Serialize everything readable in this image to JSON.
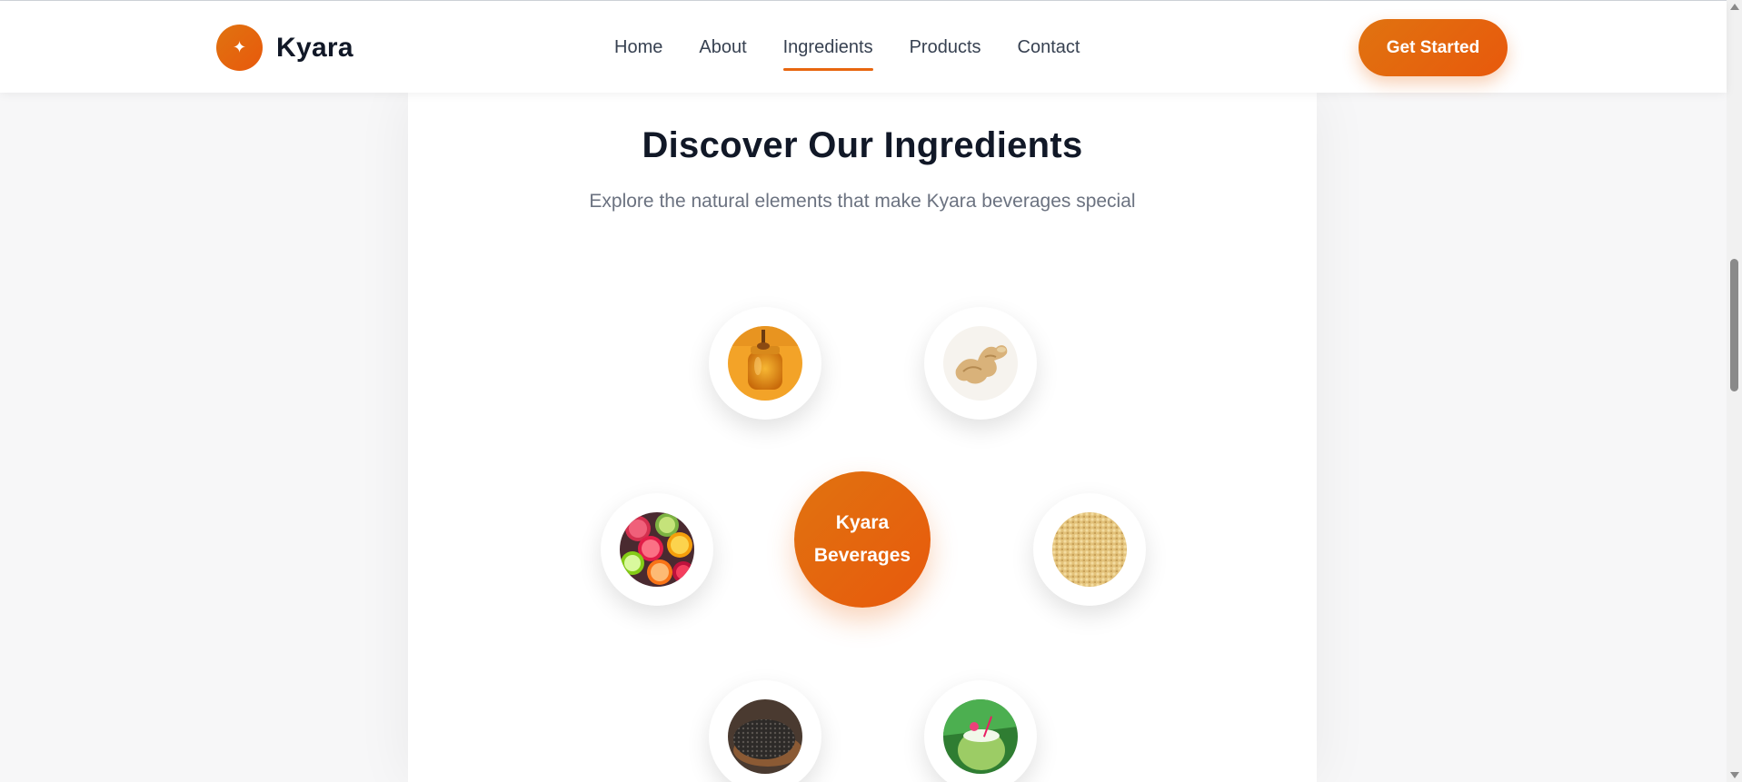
{
  "brand": {
    "name": "Kyara",
    "logo_icon": "sparkle-icon"
  },
  "nav": {
    "items": [
      {
        "label": "Home"
      },
      {
        "label": "About"
      },
      {
        "label": "Ingredients",
        "active": true
      },
      {
        "label": "Products"
      },
      {
        "label": "Contact"
      }
    ],
    "cta_label": "Get Started"
  },
  "section": {
    "title": "Discover Our Ingredients",
    "subtitle": "Explore the natural elements that make Kyara beverages special",
    "center_line1": "Kyara",
    "center_line2": "Beverages"
  },
  "ingredients": [
    {
      "name": "honey"
    },
    {
      "name": "ginger"
    },
    {
      "name": "citrus fruits"
    },
    {
      "name": "grains"
    },
    {
      "name": "chia seeds"
    },
    {
      "name": "coconut"
    }
  ],
  "colors": {
    "accent": "#e8660f",
    "accent_dark": "#e07310",
    "heading": "#111827",
    "muted": "#6b7280",
    "background": "#f7f7f8"
  }
}
